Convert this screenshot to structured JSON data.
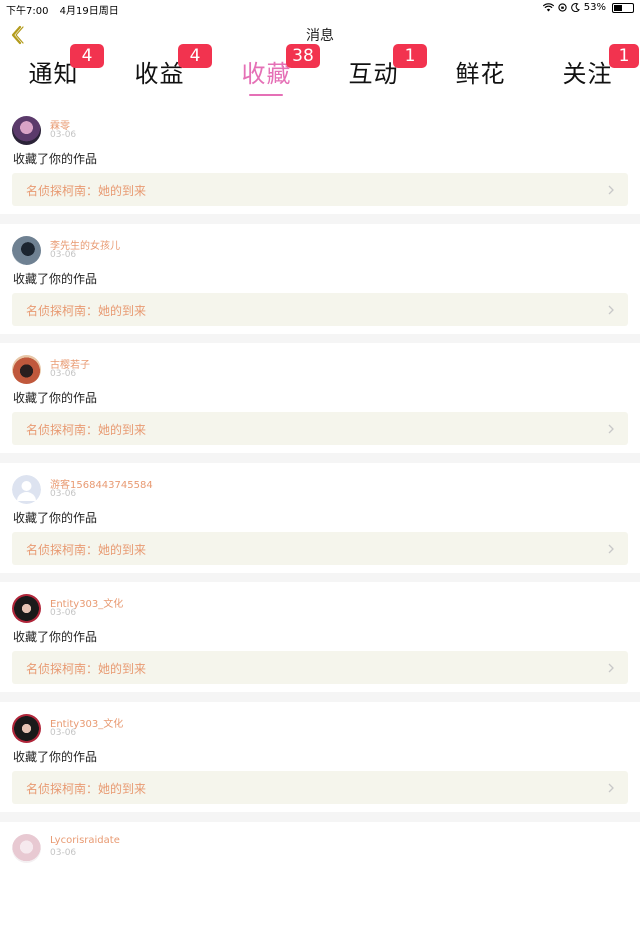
{
  "status_bar": {
    "time": "下午7:00",
    "date": "4月19日周日",
    "battery": "53%",
    "battery_level": 0.53
  },
  "header": {
    "title": "消息",
    "back_icon": "chevron-left-icon"
  },
  "tabs": [
    {
      "label": "通知",
      "badge": "4"
    },
    {
      "label": "收益",
      "badge": "4"
    },
    {
      "label": "收藏",
      "badge": "38",
      "active": true
    },
    {
      "label": "互动",
      "badge": "1"
    },
    {
      "label": "鲜花",
      "badge": ""
    },
    {
      "label": "关注",
      "badge": "1"
    }
  ],
  "colors": {
    "accent": "#e570b6",
    "badge": "#f2334f",
    "username": "#e89a72",
    "work_bg": "#f5f5ec"
  },
  "notifications": [
    {
      "user": "霖零",
      "time": "03-06",
      "text": "收藏了你的作品",
      "work": "名侦探柯南：她的到来"
    },
    {
      "user": "李先生的女孩儿",
      "time": "03-06",
      "text": "收藏了你的作品",
      "work": "名侦探柯南：她的到来"
    },
    {
      "user": "古樱若子",
      "time": "03-06",
      "text": "收藏了你的作品",
      "work": "名侦探柯南：她的到来"
    },
    {
      "user": "游客1568443745584",
      "time": "03-06",
      "text": "收藏了你的作品",
      "work": "名侦探柯南：她的到来"
    },
    {
      "user": "Entity303_文化",
      "time": "03-06",
      "text": "收藏了你的作品",
      "work": "名侦探柯南：她的到来"
    },
    {
      "user": "Entity303_文化",
      "time": "03-06",
      "text": "收藏了你的作品",
      "work": "名侦探柯南：她的到来"
    },
    {
      "user": "Lycorisraidate",
      "time": "03-06",
      "text": "",
      "work": ""
    }
  ]
}
